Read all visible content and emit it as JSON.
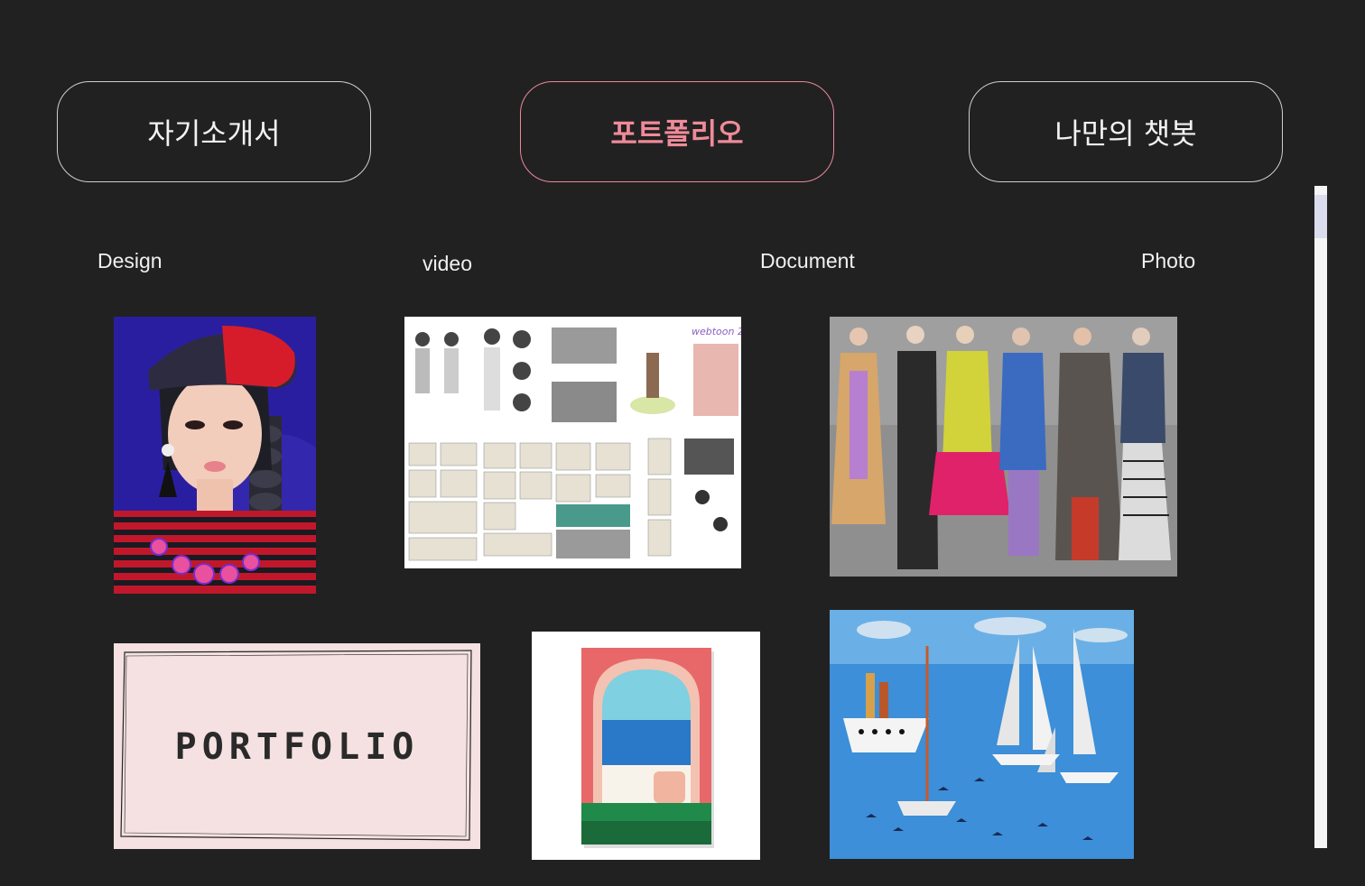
{
  "nav": {
    "items": [
      {
        "label": "자기소개서"
      },
      {
        "label": "포트폴리오"
      },
      {
        "label": "나만의 챗봇"
      }
    ]
  },
  "categories": {
    "design": "Design",
    "video": "video",
    "document": "Document",
    "photo": "Photo"
  },
  "portfolio": {
    "thumb2_caption": "webtoon 2",
    "thumb4_text": "PORTFOLIO"
  },
  "colors": {
    "background": "#212121",
    "accent": "#ef8a99"
  }
}
